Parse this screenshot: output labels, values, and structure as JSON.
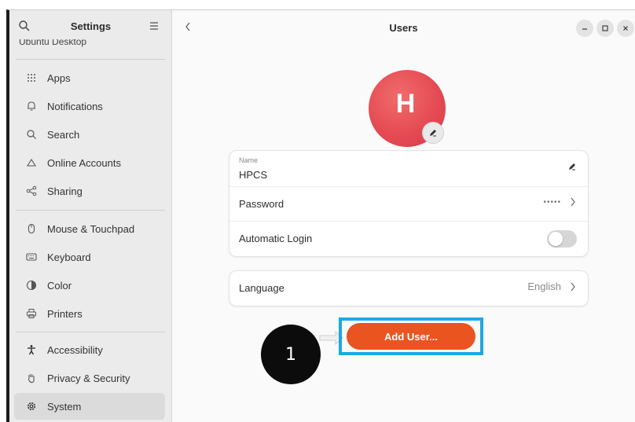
{
  "sidebar": {
    "title": "Settings",
    "partial_item": "Ubuntu Desktop",
    "items": [
      {
        "label": "Apps",
        "icon": "apps-grid-icon"
      },
      {
        "label": "Notifications",
        "icon": "bell-icon"
      },
      {
        "label": "Search",
        "icon": "search-icon"
      },
      {
        "label": "Online Accounts",
        "icon": "cloud-icon"
      },
      {
        "label": "Sharing",
        "icon": "share-icon"
      },
      {
        "label": "Mouse & Touchpad",
        "icon": "mouse-icon"
      },
      {
        "label": "Keyboard",
        "icon": "keyboard-icon"
      },
      {
        "label": "Color",
        "icon": "color-icon"
      },
      {
        "label": "Printers",
        "icon": "printer-icon"
      },
      {
        "label": "Accessibility",
        "icon": "accessibility-icon"
      },
      {
        "label": "Privacy & Security",
        "icon": "hand-icon"
      },
      {
        "label": "System",
        "icon": "gear-icon"
      }
    ],
    "active_item": "System"
  },
  "header": {
    "title": "Users"
  },
  "avatar": {
    "letter": "H",
    "color": "#e54b53"
  },
  "user_card": {
    "name_caption": "Name",
    "name_value": "HPCS",
    "password_label": "Password",
    "password_value": "•••••",
    "autologin_label": "Automatic Login",
    "autologin_enabled": false
  },
  "language_card": {
    "label": "Language",
    "value": "English"
  },
  "add_user_button": {
    "label": "Add User...",
    "color": "#e95420"
  },
  "annotation": {
    "step_number": "1",
    "highlight_color": "#1ea7e6"
  }
}
